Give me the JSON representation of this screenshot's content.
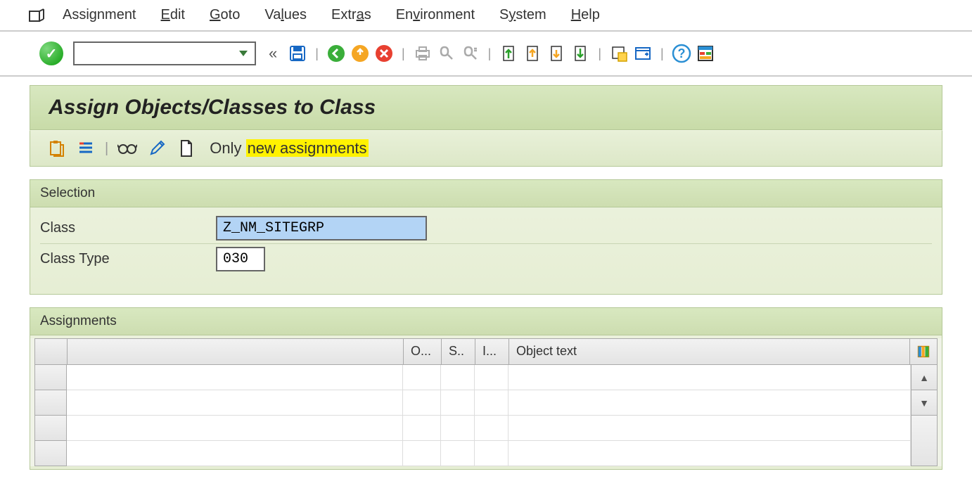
{
  "menu": {
    "assignment": "Assignment",
    "edit": "Edit",
    "goto": "Goto",
    "values": "Values",
    "extras": "Extras",
    "environment": "Environment",
    "system": "System",
    "help": "Help"
  },
  "title": "Assign Objects/Classes to Class",
  "apptoolbar": {
    "only_prefix": "Only ",
    "only_highlight": "new assignments"
  },
  "selection": {
    "header": "Selection",
    "class_label": "Class",
    "class_value": "Z_NM_SITEGRP",
    "type_label": "Class Type",
    "type_value": "030"
  },
  "assignments": {
    "header": "Assignments",
    "columns": {
      "o": "O...",
      "s": "S..",
      "i": "I...",
      "obj": "Object text"
    }
  }
}
